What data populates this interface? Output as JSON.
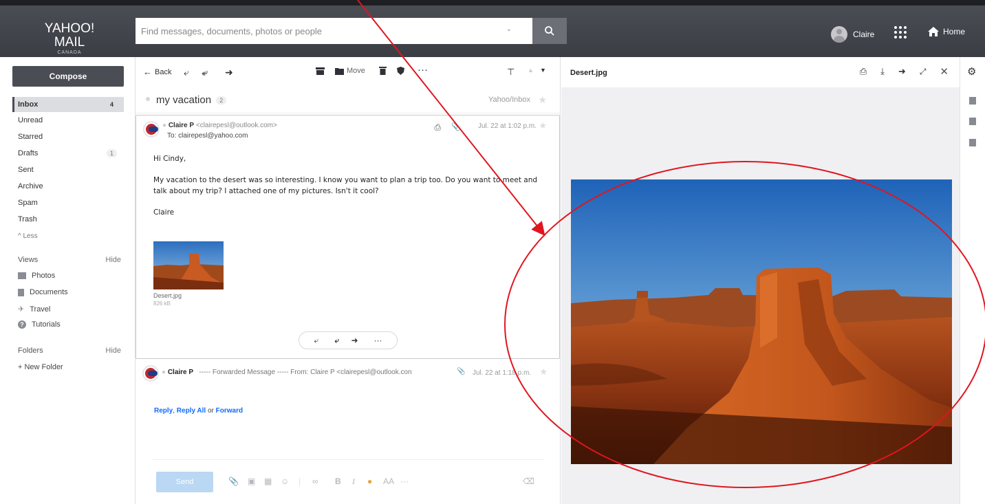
{
  "header": {
    "logo_main": "YAHOO! MAIL",
    "logo_sub": "CANADA",
    "search_placeholder": "Find messages, documents, photos or people",
    "user_name": "Claire",
    "home_label": "Home"
  },
  "sidebar": {
    "compose_label": "Compose",
    "folders": [
      {
        "label": "Inbox",
        "count": "4"
      },
      {
        "label": "Unread",
        "count": ""
      },
      {
        "label": "Starred",
        "count": ""
      },
      {
        "label": "Drafts",
        "count": "1"
      },
      {
        "label": "Sent",
        "count": ""
      },
      {
        "label": "Archive",
        "count": ""
      },
      {
        "label": "Spam",
        "count": ""
      },
      {
        "label": "Trash",
        "count": ""
      }
    ],
    "less_label": "^ Less",
    "views_label": "Views",
    "views_hide": "Hide",
    "views": [
      "Photos",
      "Documents",
      "Travel",
      "Tutorials"
    ],
    "folders_label": "Folders",
    "folders_hide": "Hide",
    "new_folder": "+ New Folder"
  },
  "toolbar": {
    "back_label": "Back",
    "move_label": "Move",
    "more_label": "···"
  },
  "conversation": {
    "subject": "my vacation",
    "count": "2",
    "folder": "Yahoo/Inbox"
  },
  "message": {
    "sender": "Claire P",
    "sender_email": "<clairepesl@outlook.com>",
    "to": "To: clairepesl@yahoo.com",
    "date": "Jul. 22 at 1:02 p.m.",
    "greeting": "Hi Cindy,",
    "body": "My vacation to the desert was so interesting. I know you want to plan a trip too. Do you want to meet and talk about my trip? I attached one of my pictures. Isn't it cool?",
    "signature": "Claire",
    "attachment_name": "Desert.jpg",
    "attachment_size": "826 kB"
  },
  "message2": {
    "sender": "Claire P",
    "preview": "----- Forwarded Message ----- From: Claire P <clairepesl@outlook.con",
    "date": "Jul. 22 at 1:18 p.m."
  },
  "reply": {
    "reply": "Reply",
    "sep1": ", ",
    "reply_all": "Reply All",
    "or": " or ",
    "forward": "Forward",
    "send_label": "Send"
  },
  "viewer": {
    "title": "Desert.jpg"
  },
  "colors": {
    "header": "#3b3d44",
    "accent_link": "#0f69ff",
    "annotation": "#e0151f"
  }
}
